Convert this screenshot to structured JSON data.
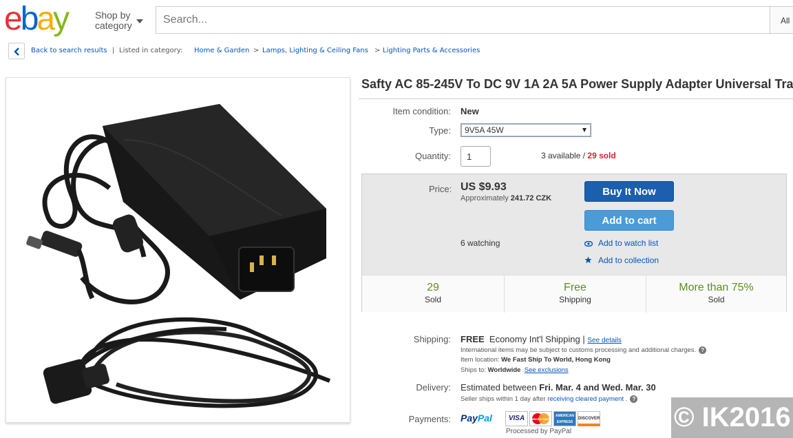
{
  "header": {
    "logo": [
      "e",
      "b",
      "a",
      "y"
    ],
    "shop_by": "Shop by",
    "category": "category",
    "search_placeholder": "Search...",
    "all_categories": "All"
  },
  "breadcrumb": {
    "back": "Back to search results",
    "sep": "|",
    "listed_in": "Listed in category:",
    "items": [
      "Home & Garden",
      "Lamps, Lighting & Ceiling Fans",
      "Lighting Parts & Accessories"
    ],
    "arrow": ">"
  },
  "product": {
    "title": "Safty AC 85-245V To DC 9V 1A 2A 5A Power Supply Adapter Universal Tra",
    "condition_label": "Item condition:",
    "condition": "New",
    "type_label": "Type:",
    "type_value": "9V5A 45W",
    "quantity_label": "Quantity:",
    "quantity": "1",
    "available": "3 available",
    "slash": " / ",
    "sold": "29 sold"
  },
  "buybox": {
    "price_label": "Price:",
    "price": "US $9.93",
    "approx_prefix": "Approximately",
    "approx_value": "241.72 CZK",
    "watching": "6 watching",
    "buy_now": "Buy It Now",
    "add_to_cart": "Add to cart",
    "watch_list": "Add to watch list",
    "collection": "Add to collection",
    "stats": [
      {
        "big": "29",
        "small": "Sold"
      },
      {
        "big": "Free",
        "small": "Shipping"
      },
      {
        "big": "More than 75%",
        "small": "Sold"
      }
    ]
  },
  "shipping": {
    "label": "Shipping:",
    "free": "FREE",
    "method": "Economy Int'l Shipping",
    "sep": "|",
    "see_details": "See details",
    "intl_note": "International items may be subject to customs processing and additional charges.",
    "location_label": "Item location:",
    "location": "We Fast Ship To World, Hong Kong",
    "ships_to_label": "Ships to:",
    "ships_to": "Worldwide",
    "see_exclusions": "See exclusions"
  },
  "delivery": {
    "label": "Delivery:",
    "prefix": "Estimated between",
    "dates": "Fri. Mar. 4 and Wed. Mar. 30",
    "note_prefix": "Seller ships within 1 day after",
    "note_link": "receiving cleared payment",
    "note_suffix": "."
  },
  "payments": {
    "label": "Payments:",
    "paypal_1": "Pay",
    "paypal_2": "Pal",
    "cards": [
      "VISA",
      "MasterCard",
      "AMERICAN EXPRESS",
      "DISCOVER"
    ],
    "processed": "Processed by PayPal"
  },
  "watermark": "© IK2016",
  "colors": {
    "ebay_red": "#e53238",
    "ebay_blue": "#0064d2",
    "ebay_yellow": "#f5af02",
    "ebay_green": "#86b817",
    "link": "#0654ba",
    "buy_button": "#1c5fae",
    "cart_button": "#4a9bd8",
    "stat_green": "#5a8e1f",
    "sold_red": "#dd1e31"
  }
}
